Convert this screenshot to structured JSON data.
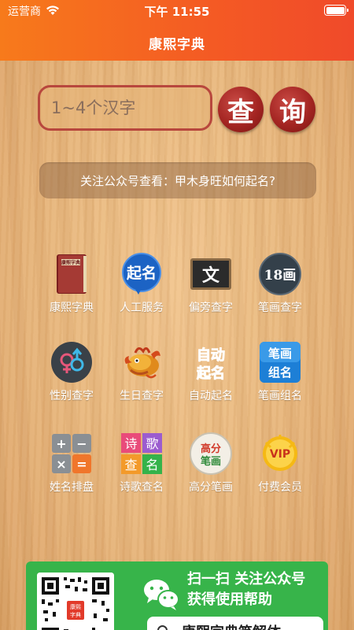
{
  "status_bar": {
    "carrier": "运营商",
    "time": "下午 11:55"
  },
  "app": {
    "title": "康熙字典"
  },
  "search": {
    "placeholder": "1~4个汉字",
    "btn1": "查",
    "btn2": "询"
  },
  "notice": "关注公众号查看：甲木身旺如何起名?",
  "grid": [
    {
      "label": "康熙字典",
      "icon": "book-icon"
    },
    {
      "label": "人工服务",
      "icon": "qiming-badge-icon",
      "icon_text": "起名"
    },
    {
      "label": "偏旁查字",
      "icon": "blackboard-icon",
      "icon_text": "文"
    },
    {
      "label": "笔画查字",
      "icon": "stroke-18-icon",
      "icon_text": "18画"
    },
    {
      "label": "性别查字",
      "icon": "gender-icon"
    },
    {
      "label": "生日查字",
      "icon": "dragon-icon"
    },
    {
      "label": "自动起名",
      "icon": "auto-name-icon",
      "icon_text": [
        "自动",
        "起名"
      ]
    },
    {
      "label": "笔画组名",
      "icon": "stroke-name-icon",
      "icon_text": [
        "笔画",
        "组名"
      ]
    },
    {
      "label": "姓名排盘",
      "icon": "calculator-icon"
    },
    {
      "label": "诗歌查名",
      "icon": "poem-tiles-icon",
      "icon_text": [
        "诗",
        "歌",
        "查",
        "名"
      ]
    },
    {
      "label": "高分笔画",
      "icon": "high-score-icon",
      "icon_text": [
        "高分",
        "笔画"
      ]
    },
    {
      "label": "付费会员",
      "icon": "vip-icon",
      "icon_text": "VIP"
    }
  ],
  "promo": {
    "line1": "扫一扫 关注公众号",
    "line2": "获得使用帮助",
    "search_text": "康熙字典笔解体",
    "qr_label": [
      "康熙",
      "字典"
    ]
  },
  "colors": {
    "header_orange": "#f77a1b",
    "header_red": "#f04a2a",
    "search_red": "#a42522",
    "promo_green": "#37b44a"
  }
}
